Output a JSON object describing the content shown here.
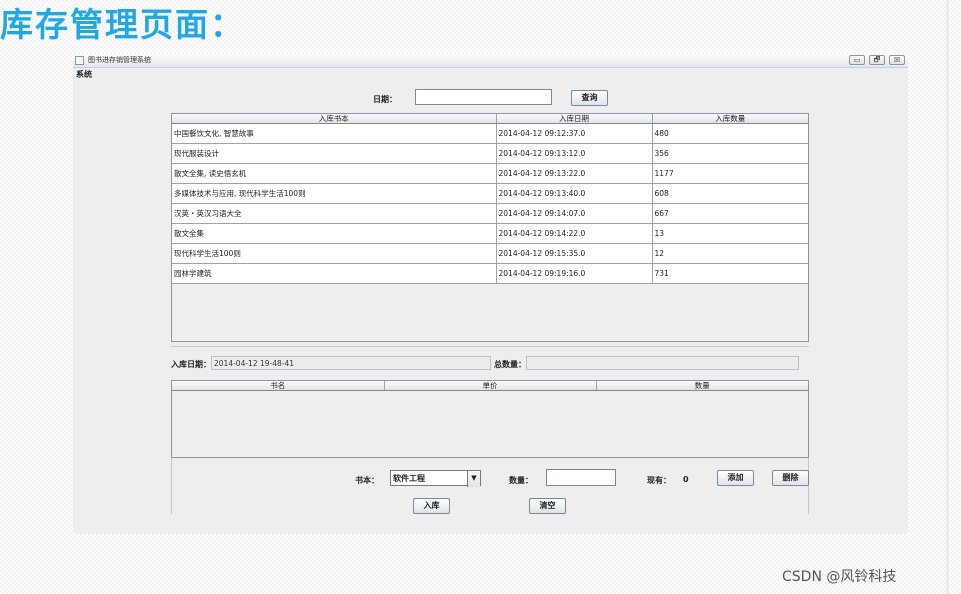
{
  "page_heading": "库存管理页面：",
  "watermark": "CSDN @风铃科技",
  "window": {
    "title": "图书进存销管理系统",
    "controls": {
      "minimize": "▭",
      "maximize": "🗗",
      "close": "☒"
    },
    "menu": [
      "系统"
    ]
  },
  "query": {
    "date_label": "日期：",
    "date_value": "",
    "query_button": "查询"
  },
  "stock_table": {
    "columns": [
      "入库书本",
      "入库日期",
      "入库数量"
    ],
    "rows": [
      [
        "中国餐饮文化, 智慧故事",
        "2014-04-12 09:12:37.0",
        "480"
      ],
      [
        "现代服装设计",
        "2014-04-12 09:13:12.0",
        "356"
      ],
      [
        "散文全集, 读史悟玄机",
        "2014-04-12 09:13:22.0",
        "1177"
      ],
      [
        "多媒体技术与应用, 现代科学生活100则",
        "2014-04-12 09:13:40.0",
        "608"
      ],
      [
        "汉英・英汉习语大全",
        "2014-04-12 09:14:07.0",
        "667"
      ],
      [
        "散文全集",
        "2014-04-12 09:14:22.0",
        "13"
      ],
      [
        "现代科学生活100则",
        "2014-04-12 09:15:35.0",
        "12"
      ],
      [
        "园林学建筑",
        "2014-04-12 09:19:16.0",
        "731"
      ]
    ]
  },
  "entry": {
    "date_label": "入库日期：",
    "date_value": "2014-04-12 19-48-41",
    "total_label": "总数量：",
    "total_value": ""
  },
  "detail_table": {
    "columns": [
      "书名",
      "单价",
      "数量"
    ]
  },
  "form": {
    "book_label": "书本：",
    "book_selected": "软件工程",
    "quantity_label": "数量：",
    "quantity_value": "",
    "stock_label": "现有：",
    "stock_value": "0",
    "add_button": "添加",
    "delete_button": "删除",
    "stockin_button": "入库",
    "clear_button": "清空"
  }
}
